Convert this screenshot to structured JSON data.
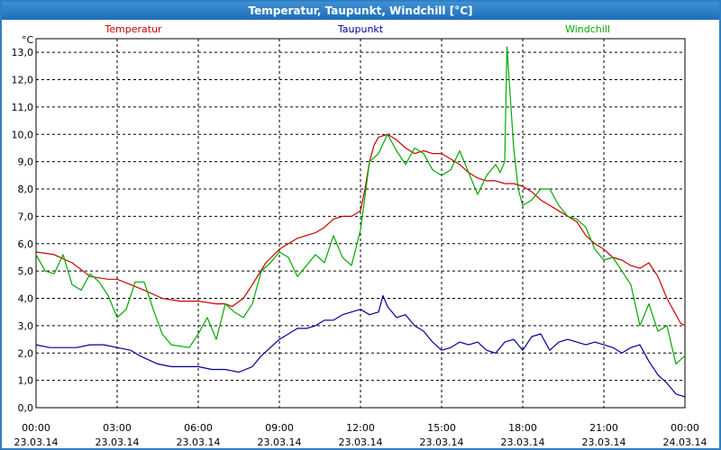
{
  "window": {
    "title": "Temperatur, Taupunkt, Windchill [°C]"
  },
  "chart_data": {
    "type": "line",
    "title": "Temperatur, Taupunkt, Windchill [°C]",
    "ylabel": "°C",
    "ylim": [
      0,
      13.5
    ],
    "yticks": [
      0,
      1,
      2,
      3,
      4,
      5,
      6,
      7,
      8,
      9,
      10,
      11,
      12,
      13
    ],
    "ytick_labels": [
      "0,0",
      "1,0",
      "2,0",
      "3,0",
      "4,0",
      "5,0",
      "6,0",
      "7,0",
      "8,0",
      "9,0",
      "10,0",
      "11,0",
      "12,0",
      "13,0"
    ],
    "xlim": [
      "23.03.14 00:00",
      "24.03.14 00:00"
    ],
    "x_unit": "time",
    "xticks": [
      {
        "time": "00:00",
        "date": "23.03.14"
      },
      {
        "time": "03:00",
        "date": "23.03.14"
      },
      {
        "time": "06:00",
        "date": "23.03.14"
      },
      {
        "time": "09:00",
        "date": "23.03.14"
      },
      {
        "time": "12:00",
        "date": "23.03.14"
      },
      {
        "time": "15:00",
        "date": "23.03.14"
      },
      {
        "time": "18:00",
        "date": "23.03.14"
      },
      {
        "time": "21:00",
        "date": "23.03.14"
      },
      {
        "time": "00:00",
        "date": "24.03.14"
      }
    ],
    "grid": true,
    "legend_position": "top",
    "series": [
      {
        "name": "Temperatur",
        "color": "#cc0000",
        "points": [
          [
            "00:00",
            5.7
          ],
          [
            "00:40",
            5.6
          ],
          [
            "01:20",
            5.3
          ],
          [
            "02:00",
            4.8
          ],
          [
            "02:40",
            4.7
          ],
          [
            "03:00",
            4.7
          ],
          [
            "03:30",
            4.5
          ],
          [
            "04:00",
            4.3
          ],
          [
            "04:40",
            4.0
          ],
          [
            "05:20",
            3.9
          ],
          [
            "06:00",
            3.9
          ],
          [
            "06:40",
            3.8
          ],
          [
            "07:00",
            3.8
          ],
          [
            "07:15",
            3.7
          ],
          [
            "07:40",
            4.0
          ],
          [
            "08:00",
            4.5
          ],
          [
            "08:30",
            5.3
          ],
          [
            "09:00",
            5.8
          ],
          [
            "09:20",
            6.0
          ],
          [
            "09:40",
            6.2
          ],
          [
            "10:00",
            6.3
          ],
          [
            "10:20",
            6.4
          ],
          [
            "10:40",
            6.6
          ],
          [
            "11:00",
            6.9
          ],
          [
            "11:20",
            7.0
          ],
          [
            "11:40",
            7.0
          ],
          [
            "12:00",
            7.2
          ],
          [
            "12:10",
            8.0
          ],
          [
            "12:20",
            9.0
          ],
          [
            "12:30",
            9.6
          ],
          [
            "12:40",
            9.9
          ],
          [
            "13:00",
            10.0
          ],
          [
            "13:20",
            9.8
          ],
          [
            "13:40",
            9.5
          ],
          [
            "14:00",
            9.3
          ],
          [
            "14:20",
            9.4
          ],
          [
            "14:40",
            9.3
          ],
          [
            "15:00",
            9.3
          ],
          [
            "15:20",
            9.1
          ],
          [
            "15:40",
            8.9
          ],
          [
            "16:00",
            8.6
          ],
          [
            "16:20",
            8.4
          ],
          [
            "16:40",
            8.3
          ],
          [
            "17:00",
            8.3
          ],
          [
            "17:20",
            8.2
          ],
          [
            "17:40",
            8.2
          ],
          [
            "18:00",
            8.1
          ],
          [
            "18:20",
            7.9
          ],
          [
            "18:40",
            7.6
          ],
          [
            "19:00",
            7.4
          ],
          [
            "19:20",
            7.2
          ],
          [
            "19:40",
            7.0
          ],
          [
            "20:00",
            6.8
          ],
          [
            "20:20",
            6.3
          ],
          [
            "20:40",
            6.0
          ],
          [
            "21:00",
            5.8
          ],
          [
            "21:20",
            5.5
          ],
          [
            "21:40",
            5.4
          ],
          [
            "22:00",
            5.2
          ],
          [
            "22:20",
            5.1
          ],
          [
            "22:40",
            5.3
          ],
          [
            "23:00",
            4.8
          ],
          [
            "23:20",
            4.0
          ],
          [
            "23:40",
            3.4
          ],
          [
            "23:50",
            3.1
          ],
          [
            "24:00",
            3.0
          ]
        ]
      },
      {
        "name": "Taupunkt",
        "color": "#00009c",
        "points": [
          [
            "00:00",
            2.3
          ],
          [
            "00:30",
            2.2
          ],
          [
            "01:00",
            2.2
          ],
          [
            "01:30",
            2.2
          ],
          [
            "02:00",
            2.3
          ],
          [
            "02:30",
            2.3
          ],
          [
            "03:00",
            2.2
          ],
          [
            "03:30",
            2.1
          ],
          [
            "03:50",
            1.9
          ],
          [
            "04:30",
            1.6
          ],
          [
            "05:00",
            1.5
          ],
          [
            "05:30",
            1.5
          ],
          [
            "06:00",
            1.5
          ],
          [
            "06:30",
            1.4
          ],
          [
            "07:00",
            1.4
          ],
          [
            "07:30",
            1.3
          ],
          [
            "08:00",
            1.5
          ],
          [
            "08:20",
            1.9
          ],
          [
            "08:40",
            2.2
          ],
          [
            "09:00",
            2.5
          ],
          [
            "09:20",
            2.7
          ],
          [
            "09:40",
            2.9
          ],
          [
            "10:00",
            2.9
          ],
          [
            "10:20",
            3.0
          ],
          [
            "10:40",
            3.2
          ],
          [
            "11:00",
            3.2
          ],
          [
            "11:20",
            3.4
          ],
          [
            "11:40",
            3.5
          ],
          [
            "12:00",
            3.6
          ],
          [
            "12:20",
            3.4
          ],
          [
            "12:40",
            3.5
          ],
          [
            "12:50",
            4.1
          ],
          [
            "13:00",
            3.7
          ],
          [
            "13:20",
            3.3
          ],
          [
            "13:40",
            3.4
          ],
          [
            "14:00",
            3.0
          ],
          [
            "14:20",
            2.8
          ],
          [
            "14:40",
            2.4
          ],
          [
            "15:00",
            2.1
          ],
          [
            "15:20",
            2.2
          ],
          [
            "15:40",
            2.4
          ],
          [
            "16:00",
            2.3
          ],
          [
            "16:20",
            2.4
          ],
          [
            "16:40",
            2.1
          ],
          [
            "17:00",
            2.0
          ],
          [
            "17:20",
            2.4
          ],
          [
            "17:40",
            2.5
          ],
          [
            "18:00",
            2.1
          ],
          [
            "18:20",
            2.6
          ],
          [
            "18:40",
            2.7
          ],
          [
            "19:00",
            2.1
          ],
          [
            "19:20",
            2.4
          ],
          [
            "19:40",
            2.5
          ],
          [
            "20:00",
            2.4
          ],
          [
            "20:20",
            2.3
          ],
          [
            "20:40",
            2.4
          ],
          [
            "21:00",
            2.3
          ],
          [
            "21:20",
            2.2
          ],
          [
            "21:40",
            2.0
          ],
          [
            "22:00",
            2.2
          ],
          [
            "22:20",
            2.3
          ],
          [
            "22:40",
            1.7
          ],
          [
            "23:00",
            1.2
          ],
          [
            "23:20",
            0.9
          ],
          [
            "23:40",
            0.5
          ],
          [
            "24:00",
            0.4
          ]
        ]
      },
      {
        "name": "Windchill",
        "color": "#00aa00",
        "points": [
          [
            "00:00",
            5.6
          ],
          [
            "00:20",
            5.0
          ],
          [
            "00:40",
            4.9
          ],
          [
            "01:00",
            5.6
          ],
          [
            "01:20",
            4.5
          ],
          [
            "01:40",
            4.3
          ],
          [
            "02:00",
            4.9
          ],
          [
            "02:20",
            4.6
          ],
          [
            "02:40",
            4.1
          ],
          [
            "03:00",
            3.3
          ],
          [
            "03:20",
            3.6
          ],
          [
            "03:40",
            4.6
          ],
          [
            "04:00",
            4.6
          ],
          [
            "04:20",
            3.6
          ],
          [
            "04:40",
            2.7
          ],
          [
            "05:00",
            2.3
          ],
          [
            "05:40",
            2.2
          ],
          [
            "06:00",
            2.7
          ],
          [
            "06:20",
            3.3
          ],
          [
            "06:40",
            2.5
          ],
          [
            "07:00",
            3.8
          ],
          [
            "07:20",
            3.5
          ],
          [
            "07:40",
            3.3
          ],
          [
            "08:00",
            3.8
          ],
          [
            "08:20",
            5.0
          ],
          [
            "08:40",
            5.3
          ],
          [
            "09:00",
            5.7
          ],
          [
            "09:20",
            5.5
          ],
          [
            "09:40",
            4.8
          ],
          [
            "10:00",
            5.2
          ],
          [
            "10:20",
            5.6
          ],
          [
            "10:40",
            5.3
          ],
          [
            "11:00",
            6.3
          ],
          [
            "11:20",
            5.5
          ],
          [
            "11:40",
            5.2
          ],
          [
            "12:00",
            6.5
          ],
          [
            "12:20",
            9.0
          ],
          [
            "12:40",
            9.3
          ],
          [
            "13:00",
            10.0
          ],
          [
            "13:20",
            9.4
          ],
          [
            "13:40",
            8.9
          ],
          [
            "14:00",
            9.5
          ],
          [
            "14:20",
            9.3
          ],
          [
            "14:40",
            8.7
          ],
          [
            "15:00",
            8.5
          ],
          [
            "15:20",
            8.7
          ],
          [
            "15:40",
            9.4
          ],
          [
            "16:00",
            8.6
          ],
          [
            "16:20",
            7.8
          ],
          [
            "16:40",
            8.5
          ],
          [
            "17:00",
            8.9
          ],
          [
            "17:10",
            8.6
          ],
          [
            "17:20",
            9.0
          ],
          [
            "17:25",
            13.2
          ],
          [
            "17:40",
            9.5
          ],
          [
            "17:50",
            8.0
          ],
          [
            "18:00",
            7.4
          ],
          [
            "18:20",
            7.6
          ],
          [
            "18:40",
            8.0
          ],
          [
            "19:00",
            8.0
          ],
          [
            "19:20",
            7.4
          ],
          [
            "19:40",
            7.0
          ],
          [
            "20:00",
            6.9
          ],
          [
            "20:20",
            6.6
          ],
          [
            "20:40",
            5.8
          ],
          [
            "21:00",
            5.4
          ],
          [
            "21:20",
            5.5
          ],
          [
            "21:40",
            5.0
          ],
          [
            "22:00",
            4.5
          ],
          [
            "22:20",
            3.0
          ],
          [
            "22:40",
            3.8
          ],
          [
            "23:00",
            2.8
          ],
          [
            "23:20",
            3.0
          ],
          [
            "23:40",
            1.6
          ],
          [
            "24:00",
            1.9
          ]
        ]
      }
    ]
  }
}
